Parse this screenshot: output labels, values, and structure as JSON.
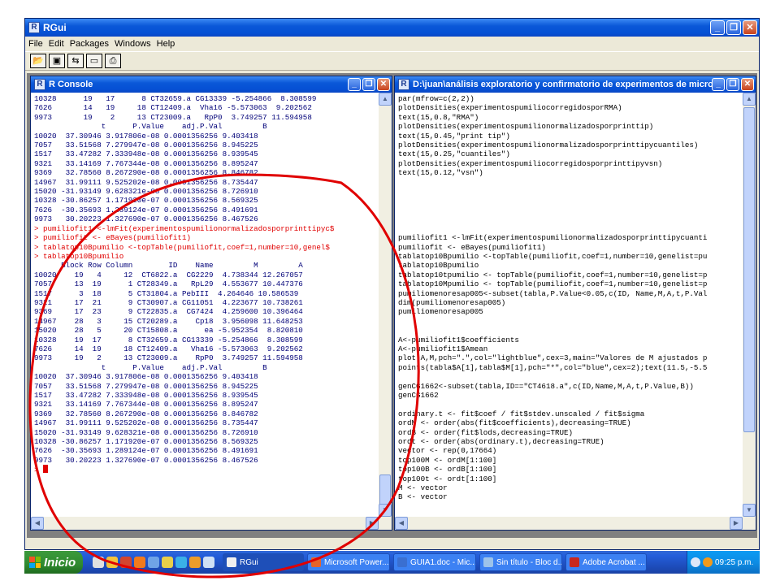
{
  "main_window": {
    "title": "RGui",
    "menu": [
      "File",
      "Edit",
      "Packages",
      "Windows",
      "Help"
    ],
    "toolbar_icons": [
      "open-script-icon",
      "save-icon",
      "load-workspace-icon",
      "console-icon",
      "print-icon"
    ]
  },
  "console": {
    "title": "R Console",
    "lines": [
      "10328      19   17      8 CT32659.a CG13339 -5.254866  8.308599",
      "7626       14   19     18 CT12409.a  Vha16 -5.573063  9.202562",
      "9973       19    2     13 CT23009.a   RpP0  3.749257 11.594958",
      "               t      P.Value    adj.P.Val         B",
      "10020  37.30946 3.917806e-08 0.0001356256 9.403418",
      "7057   33.51568 7.279947e-08 0.0001356256 8.945225",
      "1517   33.47282 7.333948e-08 0.0001356256 8.939545",
      "9321   33.14169 7.767344e-08 0.0001356256 8.895247",
      "9369   32.78560 8.267290e-08 0.0001356256 8.846782",
      "14967  31.99111 9.525202e-08 0.0001356256 8.735447",
      "15020 -31.93149 9.628321e-08 0.0001356256 8.726910",
      "10328 -30.86257 1.171920e-07 0.0001356256 8.569325",
      "7626  -30.35693 1.289124e-07 0.0001356256 8.491691",
      "9973   30.20223 1.327690e-07 0.0001356256 8.467526",
      "> pumiliofit1 <-lmFit(experimentospumilionormalizadosporprinttipyc$",
      "> pumiliofit <- eBayes(pumiliofit1)",
      "> tablatop10Bpumilio <-topTable(pumiliofit,coef=1,number=10,genel$",
      "> tablatop10Bpumilio",
      "      Block Row Column        ID    Name         M         A",
      "10020    19   4     12  CT6822.a  CG2229  4.738344 12.267057",
      "7057     13  19      1 CT28349.a   RpL29  4.553677 10.447376",
      "1517      3  18      5 CT31804.a PebIII  4.264646 10.586539",
      "9321     17  21      9 CT30907.a CG11051  4.223677 10.738261",
      "9369     17  23      9 CT22835.a  CG7424  4.259600 10.396464",
      "14967    28   3     15 CT20289.a    Cp18  3.956098 11.648253",
      "15020    28   5     20 CT15808.a      ea -5.952354  8.820810",
      "10328    19  17      8 CT32659.a CG13339 -5.254866  8.308599",
      "7626     14  19     18 CT12409.a   Vha16 -5.573063  9.202562",
      "9973     19   2     13 CT23009.a    RpP0  3.749257 11.594958",
      "               t      P.Value    adj.P.Val         B",
      "10020  37.30946 3.917806e-08 0.0001356256 9.403418",
      "7057   33.51568 7.279947e-08 0.0001356256 8.945225",
      "1517   33.47282 7.333948e-08 0.0001356256 8.939545",
      "9321   33.14169 7.767344e-08 0.0001356256 8.895247",
      "9369   32.78560 8.267290e-08 0.0001356256 8.846782",
      "14967  31.99111 9.525202e-08 0.0001356256 8.735447",
      "15020 -31.93149 9.628321e-08 0.0001356256 8.726910",
      "10328 -30.86257 1.171920e-07 0.0001356256 8.569325",
      "7626  -30.35693 1.289124e-07 0.0001356256 8.491691",
      "9973   30.20223 1.327690e-07 0.0001356256 8.467526"
    ],
    "prompt": "> "
  },
  "editor": {
    "title": "D:\\juan\\análisis exploratorio y confirmatorio de experimentos de microarr...",
    "lines": [
      "par(mfrow=c(2,2))",
      "plotDensities(experimentospumiliocorregidosporRMA)",
      "text(15,0.8,\"RMA\")",
      "plotDensities(experimentospumilionormalizadosporprinttip)",
      "text(15,0.45,\"print tip\")",
      "plotDensities(experimentospumilionormalizadosporprinttipycuantiles)",
      "text(15,0.25,\"cuantiles\")",
      "plotDensities(experimentospumiliocorregidosporprinttipyvsn)",
      "text(15,0.12,\"vsn\")",
      "",
      "",
      "",
      "",
      "",
      "",
      "pumiliofit1 <-lmFit(experimentospumilionormalizadosporprinttipycuanti",
      "pumiliofit <- eBayes(pumiliofit1)",
      "tablatop10Bpumilio <-topTable(pumiliofit,coef=1,number=10,genelist=pu",
      "tablatop10Bpumilio",
      "tablatop10tpumilio <- topTable(pumiliofit,coef=1,number=10,genelist=p",
      "tablatop10Mpumilio <- topTable(pumiliofit,coef=1,number=10,genelist=p",
      "pumiliomenoresap005<-subset(tabla,P.Value<0.05,c(ID, Name,M,A,t,P.Val",
      "dim(pumiliomenoresap005)",
      "pumiliomenoresap005",
      "",
      "",
      "A<-pumiliofit1$coefficients",
      "A<-pumiliofit1$Amean",
      "plot(A,M,pch=\".\",col=\"lightblue\",cex=3,main=\"Valores de M ajustados p",
      "points(tabla$A[1],tabla$M[1],pch=\"*\",col=\"blue\",cex=2);text(11.5,-5.5",
      "",
      "genCG1662<-subset(tabla,ID==\"CT4618.a\",c(ID,Name,M,A,t,P.Value,B))",
      "genCG1662",
      "",
      "ordinary.t <- fit$coef / fit$stdev.unscaled / fit$sigma",
      "ordM <- order(abs(fit$coefficients),decreasing=TRUE)",
      "ordB <- order(fit$lods,decreasing=TRUE)",
      "ordt <- order(abs(ordinary.t),decreasing=TRUE)",
      "vector <- rep(0,17664)",
      "top100M <- ordM[1:100]",
      "top100B <- ordB[1:100]",
      "top100t <- ordt[1:100]",
      "M <- vector",
      "B <- vector"
    ]
  },
  "taskbar": {
    "start_label": "Inicio",
    "tasks": [
      {
        "label": "RGui",
        "active": true
      },
      {
        "label": "Microsoft Power...",
        "active": false
      },
      {
        "label": "GUIA1.doc - Mic...",
        "active": false
      },
      {
        "label": "Sin título - Bloc d...",
        "active": false
      },
      {
        "label": "Adobe Acrobat ...",
        "active": false
      }
    ],
    "clock": "09:25 p.m."
  },
  "colors": {
    "console_output": "#000078",
    "console_command": "#e00000",
    "annotation": "#e00000",
    "title_bar": "#0550d4",
    "mdi_background": "#808080"
  }
}
